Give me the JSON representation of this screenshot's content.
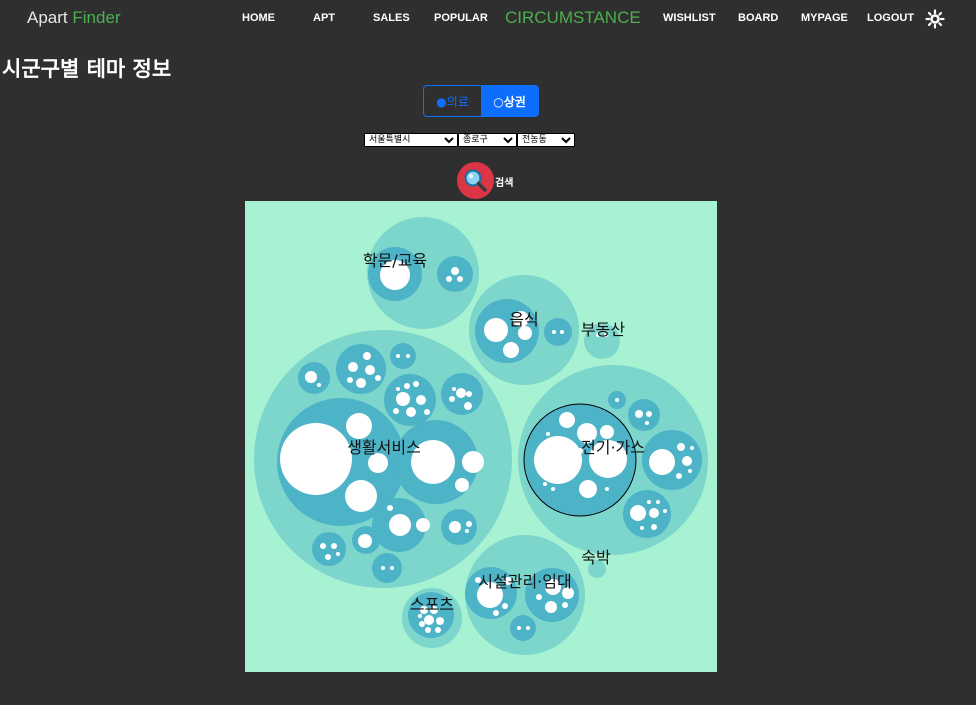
{
  "brand": {
    "name": "Apart",
    "accent": "Finder"
  },
  "nav": {
    "items": [
      {
        "label": "HOME"
      },
      {
        "label": "APT"
      },
      {
        "label": "SALES"
      },
      {
        "label": "POPULAR"
      },
      {
        "label": "CIRCUMSTANCE",
        "active": true
      },
      {
        "label": "WISHLIST"
      },
      {
        "label": "BOARD"
      },
      {
        "label": "MYPAGE"
      },
      {
        "label": "LOGOUT"
      }
    ],
    "theme_icon": "sun-icon"
  },
  "page": {
    "title": "시군구별 테마 정보"
  },
  "toggle": {
    "options": [
      {
        "label": "●의료",
        "selected": false
      },
      {
        "label": "○상권",
        "selected": true
      }
    ]
  },
  "filters": {
    "sido": "서울특별시",
    "gugun": "종로구",
    "dong": "전농동"
  },
  "search": {
    "icon": "magnifier-icon",
    "label": "검색"
  },
  "colors": {
    "accent": "#4caf50",
    "primary": "#0d6efd",
    "chart_bg": "#a8f2d4",
    "bubble_outer": "#7dd6cc",
    "bubble_mid": "#4db3c7",
    "bubble_leaf": "#ffffff"
  },
  "chart_data": {
    "type": "circle-packing",
    "categories": [
      {
        "name": "학문/교육"
      },
      {
        "name": "음식"
      },
      {
        "name": "부동산"
      },
      {
        "name": "생활서비스"
      },
      {
        "name": "전기·가스",
        "highlighted": true
      },
      {
        "name": "숙박"
      },
      {
        "name": "시설관리·임대"
      },
      {
        "name": "스포츠"
      }
    ]
  }
}
